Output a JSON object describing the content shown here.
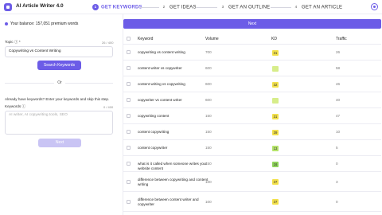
{
  "app": {
    "title": "AI Article Writer 4.0"
  },
  "steps": [
    {
      "num": "1",
      "label": "GET KEYWORDS"
    },
    {
      "num": "2",
      "label": "GET IDEAS"
    },
    {
      "num": "3",
      "label": "GET AN OUTLINE"
    },
    {
      "num": "4",
      "label": "GET AN ARTICLE"
    }
  ],
  "left": {
    "balance": "Your balance: 157,051 premium words",
    "topic_label": "Topic ⓘ *",
    "topic_count": "26 / 400",
    "topic_value": "Copywriting vs Content Writing",
    "search_button": "Search Keywords",
    "or_label": "Or",
    "already_text": "Already have keywords? Enter your keywords and skip this step.",
    "keywords_label": "Keywords ⓘ",
    "keywords_count": "0 / 400",
    "keywords_placeholder": "AI writer, AI copywriting tools, SEO",
    "next_button": "Next"
  },
  "right": {
    "next_button": "Next",
    "headers": {
      "keyword": "Keyword",
      "volume": "Volume",
      "kd": "KD",
      "traffic": "Traffic"
    },
    "rows": [
      {
        "keyword": "copywriting vs content writing",
        "volume": "700",
        "kd": "31",
        "traffic": "26",
        "kd_color": "#f2e04a"
      },
      {
        "keyword": "content writer vs copywriter",
        "volume": "600",
        "kd": "",
        "traffic": "58",
        "kd_color": "#d7ed8a"
      },
      {
        "keyword": "content writing vs copywriting",
        "volume": "600",
        "kd": "32",
        "traffic": "46",
        "kd_color": "#f2e04a"
      },
      {
        "keyword": "copywriter vs content writer",
        "volume": "600",
        "kd": "",
        "traffic": "40",
        "kd_color": "#d7ed8a"
      },
      {
        "keyword": "copywriting content",
        "volume": "150",
        "kd": "31",
        "traffic": "47",
        "kd_color": "#f2e04a"
      },
      {
        "keyword": "content copywriting",
        "volume": "150",
        "kd": "39",
        "traffic": "10",
        "kd_color": "#f2e04a"
      },
      {
        "keyword": "content copywriter",
        "volume": "150",
        "kd": "13",
        "traffic": "5",
        "kd_color": "#b5e36b"
      },
      {
        "keyword": "what is it called when someone writes your website content",
        "volume": "150",
        "kd": "16",
        "traffic": "0",
        "kd_color": "#8fd35a"
      },
      {
        "keyword": "difference between copywriting and content writing",
        "volume": "100",
        "kd": "37",
        "traffic": "3",
        "kd_color": "#f2e04a"
      },
      {
        "keyword": "difference between content writer and copywriter",
        "volume": "100",
        "kd": "37",
        "traffic": "0",
        "kd_color": "#f2e04a"
      }
    ]
  }
}
